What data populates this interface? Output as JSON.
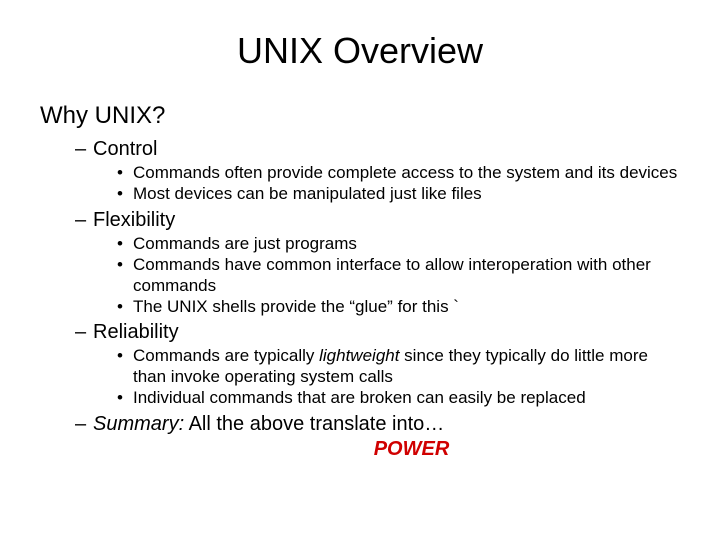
{
  "title": "UNIX Overview",
  "heading": "Why UNIX?",
  "items": [
    {
      "label": "Control",
      "sub": [
        "Commands often provide complete access to the system and its devices",
        "Most devices can be manipulated just like files"
      ]
    },
    {
      "label": "Flexibility",
      "sub": [
        "Commands are just programs",
        "Commands have common interface to allow interoperation with other commands",
        "The UNIX shells provide the “glue” for this `"
      ]
    },
    {
      "label": "Reliability",
      "sub": [
        {
          "pre": "Commands are typically ",
          "em": "lightweight",
          "post": " since they typically do little more than invoke operating system calls"
        },
        "Individual commands that are broken can easily be replaced"
      ]
    }
  ],
  "summary": {
    "label": "Summary:",
    "text": "  All the above translate into…"
  },
  "power": "POWER"
}
